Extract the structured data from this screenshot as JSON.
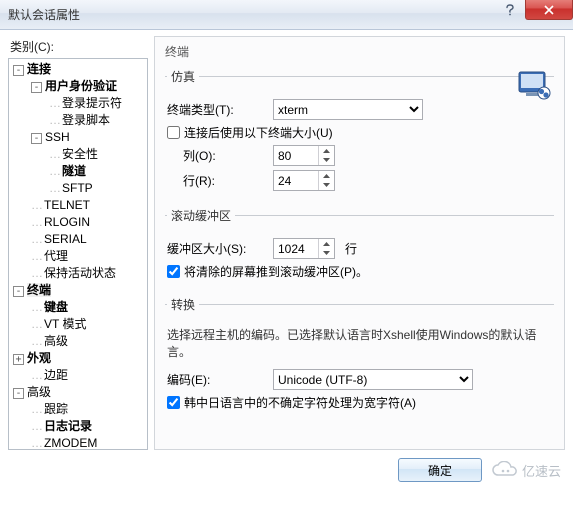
{
  "window": {
    "title": "默认会话属性",
    "help_icon": "help-icon",
    "close_icon": "close-icon"
  },
  "sidebar": {
    "label": "类别(C):",
    "tree": {
      "connection": "连接",
      "auth": "用户身份验证",
      "login_prompt": "登录提示符",
      "login_script": "登录脚本",
      "ssh": "SSH",
      "security": "安全性",
      "tunnel": "隧道",
      "sftp": "SFTP",
      "telnet": "TELNET",
      "rlogin": "RLOGIN",
      "serial": "SERIAL",
      "proxy": "代理",
      "keepalive": "保持活动状态",
      "terminal": "终端",
      "keyboard": "键盘",
      "vt": "VT 模式",
      "adv": "高级",
      "appearance": "外观",
      "margin": "边距",
      "advanced": "高级",
      "trace": "跟踪",
      "logging": "日志记录",
      "zmodem": "ZMODEM"
    }
  },
  "panel": {
    "title": "终端",
    "emu": {
      "legend": "仿真",
      "term_type_label": "终端类型(T):",
      "term_type_value": "xterm",
      "use_size_label": "连接后使用以下终端大小(U)",
      "use_size_checked": false,
      "cols_label": "列(O):",
      "cols_value": "80",
      "rows_label": "行(R):",
      "rows_value": "24"
    },
    "scroll": {
      "legend": "滚动缓冲区",
      "size_label": "缓冲区大小(S):",
      "size_value": "1024",
      "size_unit": "行",
      "push_label": "将清除的屏幕推到滚动缓冲区(P)。",
      "push_checked": true
    },
    "encoding": {
      "legend": "转换",
      "desc": "选择远程主机的编码。已选择默认语言时Xshell使用Windows的默认语言。",
      "enc_label": "编码(E):",
      "enc_value": "Unicode (UTF-8)",
      "wide_label": "韩中日语言中的不确定字符处理为宽字符(A)",
      "wide_checked": true
    }
  },
  "footer": {
    "ok": "确定",
    "brand": "亿速云"
  }
}
